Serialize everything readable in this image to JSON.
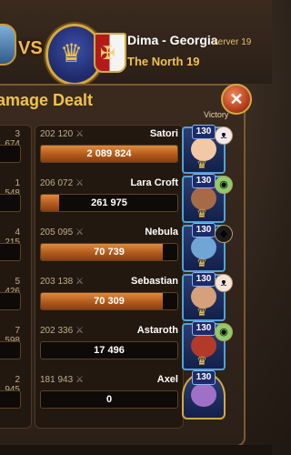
{
  "header": {
    "vs_label": "VS",
    "player_name": "Dima - Georgia",
    "server": "Server 19",
    "guild_name": "The North 19"
  },
  "panel": {
    "title": "amage Dealt",
    "victory_label": "Victory",
    "close_symbol": "✕"
  },
  "colors": {
    "accent_gold": "#f0c24a",
    "bar_orange": "#c96a26",
    "frame_blue": "#4fa3d8"
  },
  "left_rows": [
    {
      "power": "3 674"
    },
    {
      "power": "1 548"
    },
    {
      "power": "4 215"
    },
    {
      "power": "5 426"
    },
    {
      "power": "7 598"
    },
    {
      "power": "2 945"
    }
  ],
  "rows": [
    {
      "power": "202 120",
      "name": "Satori",
      "damage": "2 089 824",
      "damage_fraction": 1.0,
      "level": "130",
      "pet": "cat-pet-icon",
      "victory_icon": "victory-crown-icon"
    },
    {
      "power": "206 072",
      "name": "Lara Croft",
      "damage": "261 975",
      "damage_fraction": 0.13,
      "level": "130",
      "pet": "egg-pet-icon",
      "victory_icon": "victory-crown-icon"
    },
    {
      "power": "205 095",
      "name": "Nebula",
      "damage": "70 739",
      "damage_fraction": 0.035,
      "level": "130",
      "pet": "shadow-pet-icon",
      "victory_icon": "victory-crown-icon"
    },
    {
      "power": "203 138",
      "name": "Sebastian",
      "damage": "70 309",
      "damage_fraction": 0.034,
      "level": "130",
      "pet": "fox-pet-icon",
      "victory_icon": "victory-crown-icon"
    },
    {
      "power": "202 336",
      "name": "Astaroth",
      "damage": "17 496",
      "damage_fraction": 0.0,
      "level": "130",
      "pet": "egg-pet-icon",
      "victory_icon": "victory-crown-icon"
    },
    {
      "power": "181 943",
      "name": "Axel",
      "damage": "0",
      "damage_fraction": 0.0,
      "level": "130",
      "pet": "",
      "victory_icon": ""
    }
  ]
}
